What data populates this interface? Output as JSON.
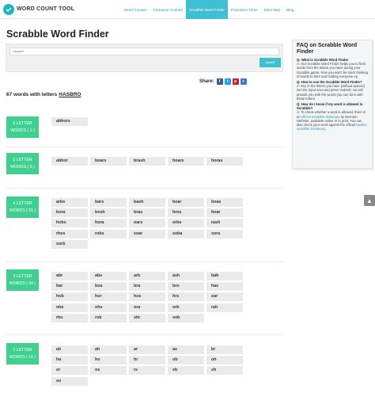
{
  "header": {
    "logo_text": "WORD COUNT TOOL",
    "nav": [
      {
        "label": "Word Counter",
        "active": false
      },
      {
        "label": "Character Counter",
        "active": false
      },
      {
        "label": "Scrabble Word Finder",
        "active": true
      },
      {
        "label": "Pomodoro Timer",
        "active": false
      },
      {
        "label": "Mind Map",
        "active": false
      },
      {
        "label": "Blog",
        "active": false
      }
    ]
  },
  "page_title": "Scrabble Word Finder",
  "search": {
    "value": "rasqwet",
    "submit_label": "submit"
  },
  "share": {
    "label": "Share:",
    "buttons": [
      {
        "name": "facebook",
        "glyph": "f",
        "color": "#3b5998"
      },
      {
        "name": "twitter",
        "glyph": "t",
        "color": "#1da1f2"
      },
      {
        "name": "pinterest",
        "glyph": "p",
        "color": "#cb2027"
      },
      {
        "name": "more",
        "glyph": "+",
        "color": "#3b7bd4"
      }
    ]
  },
  "results": {
    "count_text": "67 words with letters",
    "letters": "HASBRO"
  },
  "groups": [
    {
      "label_line1": "6 LETTER",
      "label_line2": "WORDS ( 1 )",
      "words": [
        "abhors"
      ]
    },
    {
      "label_line1": "5 LETTER",
      "label_line2": "WORDS ( 5 )",
      "words": [
        "abhor",
        "boars",
        "brash",
        "hoars",
        "horas"
      ]
    },
    {
      "label_line1": "4 LETTER",
      "label_line2": "WORDS ( 21 )",
      "words": [
        "arbs",
        "bars",
        "bash",
        "boar",
        "boas",
        "bora",
        "bosh",
        "bras",
        "bros",
        "hoar",
        "hobs",
        "hora",
        "oars",
        "orbs",
        "rash",
        "rhos",
        "robs",
        "soar",
        "soba",
        "sora",
        "sorb"
      ]
    },
    {
      "label_line1": "3 LETTER",
      "label_line2": "WORDS ( 34 )",
      "words": [
        "abr",
        "abs",
        "arb",
        "ash",
        "bah",
        "bar",
        "boa",
        "bra",
        "bro",
        "has",
        "hob",
        "hor",
        "hos",
        "hrs",
        "oar",
        "obs",
        "ohs",
        "ora",
        "orb",
        "rah",
        "rho",
        "rob",
        "shr",
        "sob"
      ]
    },
    {
      "label_line1": "2 LETTER",
      "label_line2": "WORDS ( 16 )",
      "words": [
        "ab",
        "ah",
        "ar",
        "as",
        "br",
        "ha",
        "ho",
        "hr",
        "ob",
        "oh",
        "or",
        "os",
        "rs",
        "sb",
        "sh",
        "so"
      ]
    }
  ],
  "faq": {
    "title": "FAQ on Scrabble Word Finder",
    "items": [
      {
        "q": "Q: What is Scrabble Word Finder",
        "a": "A: Our Scrabble Word Finder helps you to form words from the letters you have during your Scrabble game. Now you won't be stuck thinking of words to form and holding everyone up"
      },
      {
        "q": "Q: How to use the Scrabble Word Finder?",
        "a": "A: Key in the letters you have (without spaces) into the input area and press 'Submit', we will provide you with the words you can form with these letters."
      },
      {
        "q": "Q: How do I know if my word is allowed in Scrabble?",
        "a_parts": [
          "A: To check whether a word is allowed, there is an ",
          "official Scrabble dictionary",
          " by Merriam-Webster, available online or in print. You can also check your word against the official ",
          "Hasbro Scrabble Dictionary",
          "."
        ]
      }
    ]
  },
  "scroll_top_glyph": "▲"
}
